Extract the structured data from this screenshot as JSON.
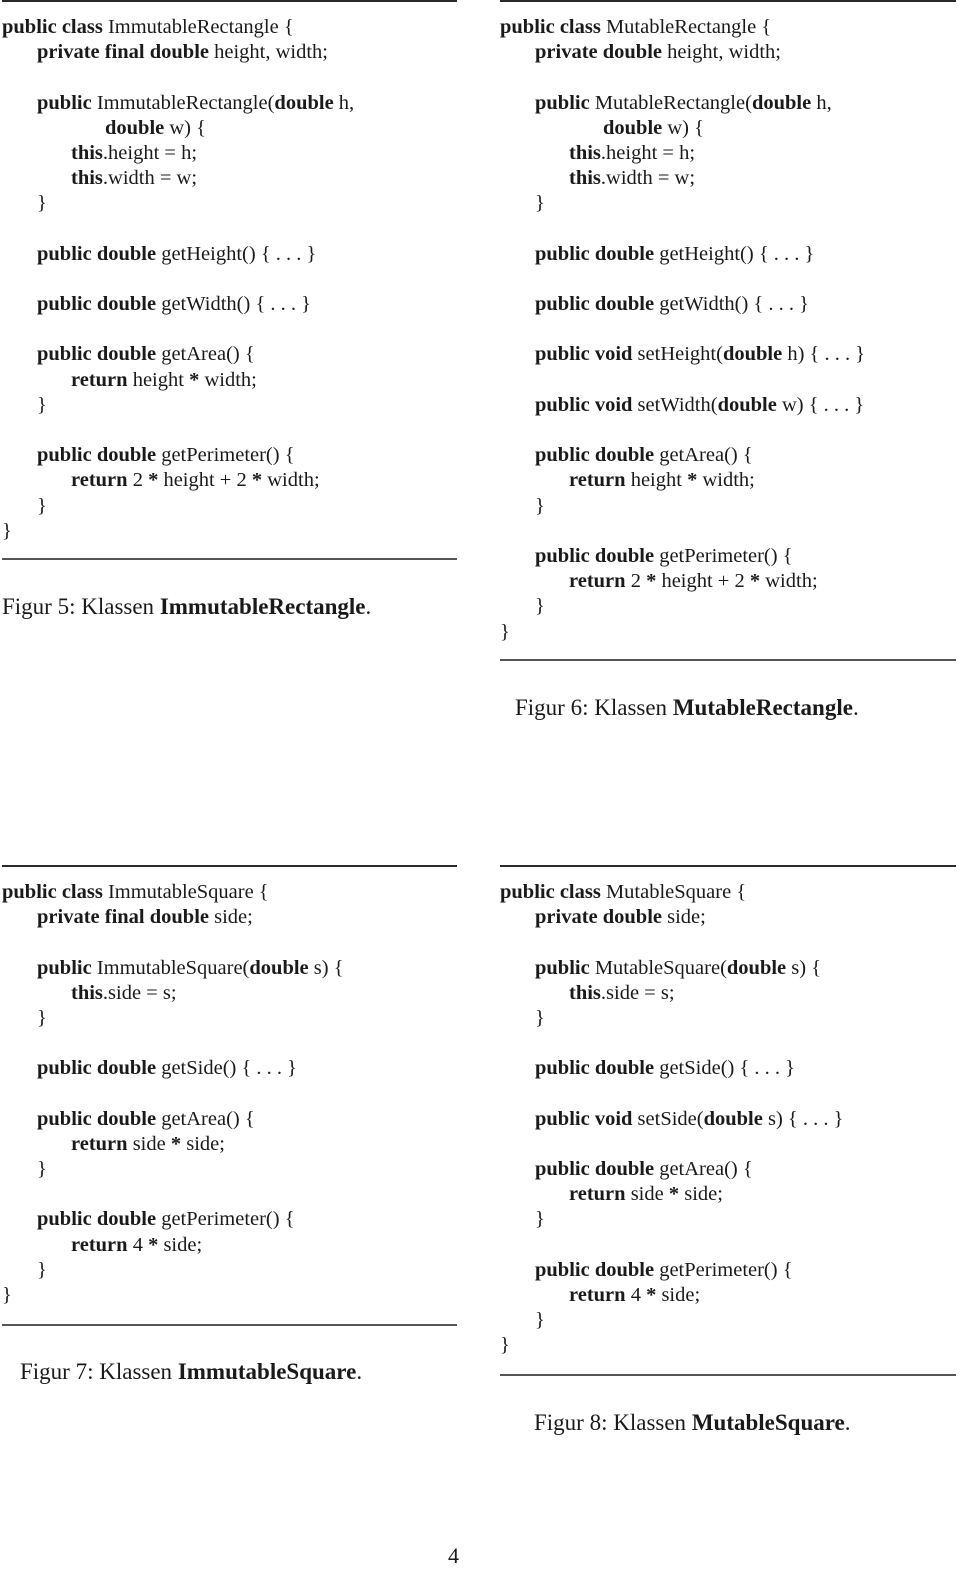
{
  "figures": [
    {
      "id": "fig5",
      "caption_prefix": "Figur 5: Klassen ",
      "caption_class": "ImmutableRectangle",
      "caption_suffix": ".",
      "lines": [
        {
          "indent": 0,
          "tokens": [
            {
              "t": "public class",
              "b": true
            },
            {
              "t": " ImmutableRectangle {"
            }
          ]
        },
        {
          "indent": 1,
          "tokens": [
            {
              "t": "private final double",
              "b": true
            },
            {
              "t": " height, width;"
            }
          ]
        },
        {
          "indent": 0,
          "tokens": []
        },
        {
          "indent": 1,
          "tokens": [
            {
              "t": "public",
              "b": true
            },
            {
              "t": " ImmutableRectangle("
            },
            {
              "t": "double",
              "b": true
            },
            {
              "t": " h,"
            }
          ]
        },
        {
          "indent": 3,
          "tokens": [
            {
              "t": "double",
              "b": true
            },
            {
              "t": " w) {"
            }
          ]
        },
        {
          "indent": 2,
          "tokens": [
            {
              "t": "this",
              "b": true
            },
            {
              "t": ".height = h;"
            }
          ]
        },
        {
          "indent": 2,
          "tokens": [
            {
              "t": "this",
              "b": true
            },
            {
              "t": ".width = w;"
            }
          ]
        },
        {
          "indent": 1,
          "tokens": [
            {
              "t": "}"
            }
          ]
        },
        {
          "indent": 0,
          "tokens": []
        },
        {
          "indent": 1,
          "tokens": [
            {
              "t": "public double",
              "b": true
            },
            {
              "t": " getHeight() { . . . }"
            }
          ]
        },
        {
          "indent": 0,
          "tokens": []
        },
        {
          "indent": 1,
          "tokens": [
            {
              "t": "public double",
              "b": true
            },
            {
              "t": " getWidth() { . . . }"
            }
          ]
        },
        {
          "indent": 0,
          "tokens": []
        },
        {
          "indent": 1,
          "tokens": [
            {
              "t": "public double",
              "b": true
            },
            {
              "t": " getArea() {"
            }
          ]
        },
        {
          "indent": 2,
          "tokens": [
            {
              "t": "return",
              "b": true
            },
            {
              "t": " height "
            },
            {
              "t": "*",
              "b": true
            },
            {
              "t": " width;"
            }
          ]
        },
        {
          "indent": 1,
          "tokens": [
            {
              "t": "}"
            }
          ]
        },
        {
          "indent": 0,
          "tokens": []
        },
        {
          "indent": 1,
          "tokens": [
            {
              "t": "public double",
              "b": true
            },
            {
              "t": " getPerimeter() {"
            }
          ]
        },
        {
          "indent": 2,
          "tokens": [
            {
              "t": "return",
              "b": true
            },
            {
              "t": " 2 "
            },
            {
              "t": "*",
              "b": true
            },
            {
              "t": " height + 2 "
            },
            {
              "t": "*",
              "b": true
            },
            {
              "t": " width;"
            }
          ]
        },
        {
          "indent": 1,
          "tokens": [
            {
              "t": "}"
            }
          ]
        },
        {
          "indent": 0,
          "tokens": [
            {
              "t": "}"
            }
          ]
        }
      ]
    },
    {
      "id": "fig6",
      "caption_prefix": "Figur 6: Klassen ",
      "caption_class": "MutableRectangle",
      "caption_suffix": ".",
      "lines": [
        {
          "indent": 0,
          "tokens": [
            {
              "t": "public class",
              "b": true
            },
            {
              "t": " MutableRectangle {"
            }
          ]
        },
        {
          "indent": 1,
          "tokens": [
            {
              "t": "private double",
              "b": true
            },
            {
              "t": " height, width;"
            }
          ]
        },
        {
          "indent": 0,
          "tokens": []
        },
        {
          "indent": 1,
          "tokens": [
            {
              "t": "public",
              "b": true
            },
            {
              "t": " MutableRectangle("
            },
            {
              "t": "double",
              "b": true
            },
            {
              "t": " h,"
            }
          ]
        },
        {
          "indent": 3,
          "tokens": [
            {
              "t": "double",
              "b": true
            },
            {
              "t": " w) {"
            }
          ]
        },
        {
          "indent": 2,
          "tokens": [
            {
              "t": "this",
              "b": true
            },
            {
              "t": ".height = h;"
            }
          ]
        },
        {
          "indent": 2,
          "tokens": [
            {
              "t": "this",
              "b": true
            },
            {
              "t": ".width = w;"
            }
          ]
        },
        {
          "indent": 1,
          "tokens": [
            {
              "t": "}"
            }
          ]
        },
        {
          "indent": 0,
          "tokens": []
        },
        {
          "indent": 1,
          "tokens": [
            {
              "t": "public double",
              "b": true
            },
            {
              "t": " getHeight() { . . . }"
            }
          ]
        },
        {
          "indent": 0,
          "tokens": []
        },
        {
          "indent": 1,
          "tokens": [
            {
              "t": "public double",
              "b": true
            },
            {
              "t": " getWidth() { . . . }"
            }
          ]
        },
        {
          "indent": 0,
          "tokens": []
        },
        {
          "indent": 1,
          "tokens": [
            {
              "t": "public void",
              "b": true
            },
            {
              "t": " setHeight("
            },
            {
              "t": "double",
              "b": true
            },
            {
              "t": " h) { . . . }"
            }
          ]
        },
        {
          "indent": 0,
          "tokens": []
        },
        {
          "indent": 1,
          "tokens": [
            {
              "t": "public void",
              "b": true
            },
            {
              "t": " setWidth("
            },
            {
              "t": "double",
              "b": true
            },
            {
              "t": " w) { . . . }"
            }
          ]
        },
        {
          "indent": 0,
          "tokens": []
        },
        {
          "indent": 1,
          "tokens": [
            {
              "t": "public double",
              "b": true
            },
            {
              "t": " getArea() {"
            }
          ]
        },
        {
          "indent": 2,
          "tokens": [
            {
              "t": "return",
              "b": true
            },
            {
              "t": " height "
            },
            {
              "t": "*",
              "b": true
            },
            {
              "t": " width;"
            }
          ]
        },
        {
          "indent": 1,
          "tokens": [
            {
              "t": "}"
            }
          ]
        },
        {
          "indent": 0,
          "tokens": []
        },
        {
          "indent": 1,
          "tokens": [
            {
              "t": "public double",
              "b": true
            },
            {
              "t": " getPerimeter() {"
            }
          ]
        },
        {
          "indent": 2,
          "tokens": [
            {
              "t": "return",
              "b": true
            },
            {
              "t": " 2 "
            },
            {
              "t": "*",
              "b": true
            },
            {
              "t": " height + 2 "
            },
            {
              "t": "*",
              "b": true
            },
            {
              "t": " width;"
            }
          ]
        },
        {
          "indent": 1,
          "tokens": [
            {
              "t": "}"
            }
          ]
        },
        {
          "indent": 0,
          "tokens": [
            {
              "t": "}"
            }
          ]
        }
      ]
    },
    {
      "id": "fig7",
      "caption_prefix": "Figur 7: Klassen ",
      "caption_class": "ImmutableSquare",
      "caption_suffix": ".",
      "lines": [
        {
          "indent": 0,
          "tokens": [
            {
              "t": "public class",
              "b": true
            },
            {
              "t": " ImmutableSquare {"
            }
          ]
        },
        {
          "indent": 1,
          "tokens": [
            {
              "t": "private final double",
              "b": true
            },
            {
              "t": " side;"
            }
          ]
        },
        {
          "indent": 0,
          "tokens": []
        },
        {
          "indent": 1,
          "tokens": [
            {
              "t": "public",
              "b": true
            },
            {
              "t": " ImmutableSquare("
            },
            {
              "t": "double",
              "b": true
            },
            {
              "t": " s) {"
            }
          ]
        },
        {
          "indent": 2,
          "tokens": [
            {
              "t": "this",
              "b": true
            },
            {
              "t": ".side = s;"
            }
          ]
        },
        {
          "indent": 1,
          "tokens": [
            {
              "t": "}"
            }
          ]
        },
        {
          "indent": 0,
          "tokens": []
        },
        {
          "indent": 1,
          "tokens": [
            {
              "t": "public double",
              "b": true
            },
            {
              "t": " getSide() { . . . }"
            }
          ]
        },
        {
          "indent": 0,
          "tokens": []
        },
        {
          "indent": 1,
          "tokens": [
            {
              "t": "public double",
              "b": true
            },
            {
              "t": " getArea() {"
            }
          ]
        },
        {
          "indent": 2,
          "tokens": [
            {
              "t": "return",
              "b": true
            },
            {
              "t": " side "
            },
            {
              "t": "*",
              "b": true
            },
            {
              "t": " side;"
            }
          ]
        },
        {
          "indent": 1,
          "tokens": [
            {
              "t": "}"
            }
          ]
        },
        {
          "indent": 0,
          "tokens": []
        },
        {
          "indent": 1,
          "tokens": [
            {
              "t": "public double",
              "b": true
            },
            {
              "t": " getPerimeter() {"
            }
          ]
        },
        {
          "indent": 2,
          "tokens": [
            {
              "t": "return",
              "b": true
            },
            {
              "t": " 4 "
            },
            {
              "t": "*",
              "b": true
            },
            {
              "t": " side;"
            }
          ]
        },
        {
          "indent": 1,
          "tokens": [
            {
              "t": "}"
            }
          ]
        },
        {
          "indent": 0,
          "tokens": [
            {
              "t": "}"
            }
          ]
        }
      ]
    },
    {
      "id": "fig8",
      "caption_prefix": "Figur 8: Klassen ",
      "caption_class": "MutableSquare",
      "caption_suffix": ".",
      "lines": [
        {
          "indent": 0,
          "tokens": [
            {
              "t": "public class",
              "b": true
            },
            {
              "t": " MutableSquare {"
            }
          ]
        },
        {
          "indent": 1,
          "tokens": [
            {
              "t": "private double",
              "b": true
            },
            {
              "t": " side;"
            }
          ]
        },
        {
          "indent": 0,
          "tokens": []
        },
        {
          "indent": 1,
          "tokens": [
            {
              "t": "public",
              "b": true
            },
            {
              "t": " MutableSquare("
            },
            {
              "t": "double",
              "b": true
            },
            {
              "t": " s) {"
            }
          ]
        },
        {
          "indent": 2,
          "tokens": [
            {
              "t": "this",
              "b": true
            },
            {
              "t": ".side = s;"
            }
          ]
        },
        {
          "indent": 1,
          "tokens": [
            {
              "t": "}"
            }
          ]
        },
        {
          "indent": 0,
          "tokens": []
        },
        {
          "indent": 1,
          "tokens": [
            {
              "t": "public double",
              "b": true
            },
            {
              "t": " getSide() { . . . }"
            }
          ]
        },
        {
          "indent": 0,
          "tokens": []
        },
        {
          "indent": 1,
          "tokens": [
            {
              "t": "public void",
              "b": true
            },
            {
              "t": " setSide("
            },
            {
              "t": "double",
              "b": true
            },
            {
              "t": " s) { . . . }"
            }
          ]
        },
        {
          "indent": 0,
          "tokens": []
        },
        {
          "indent": 1,
          "tokens": [
            {
              "t": "public double",
              "b": true
            },
            {
              "t": " getArea() {"
            }
          ]
        },
        {
          "indent": 2,
          "tokens": [
            {
              "t": "return",
              "b": true
            },
            {
              "t": " side "
            },
            {
              "t": "*",
              "b": true
            },
            {
              "t": " side;"
            }
          ]
        },
        {
          "indent": 1,
          "tokens": [
            {
              "t": "}"
            }
          ]
        },
        {
          "indent": 0,
          "tokens": []
        },
        {
          "indent": 1,
          "tokens": [
            {
              "t": "public double",
              "b": true
            },
            {
              "t": " getPerimeter() {"
            }
          ]
        },
        {
          "indent": 2,
          "tokens": [
            {
              "t": "return",
              "b": true
            },
            {
              "t": " 4 "
            },
            {
              "t": "*",
              "b": true
            },
            {
              "t": " side;"
            }
          ]
        },
        {
          "indent": 1,
          "tokens": [
            {
              "t": "}"
            }
          ]
        },
        {
          "indent": 0,
          "tokens": [
            {
              "t": "}"
            }
          ]
        }
      ]
    }
  ],
  "page_number": "4"
}
